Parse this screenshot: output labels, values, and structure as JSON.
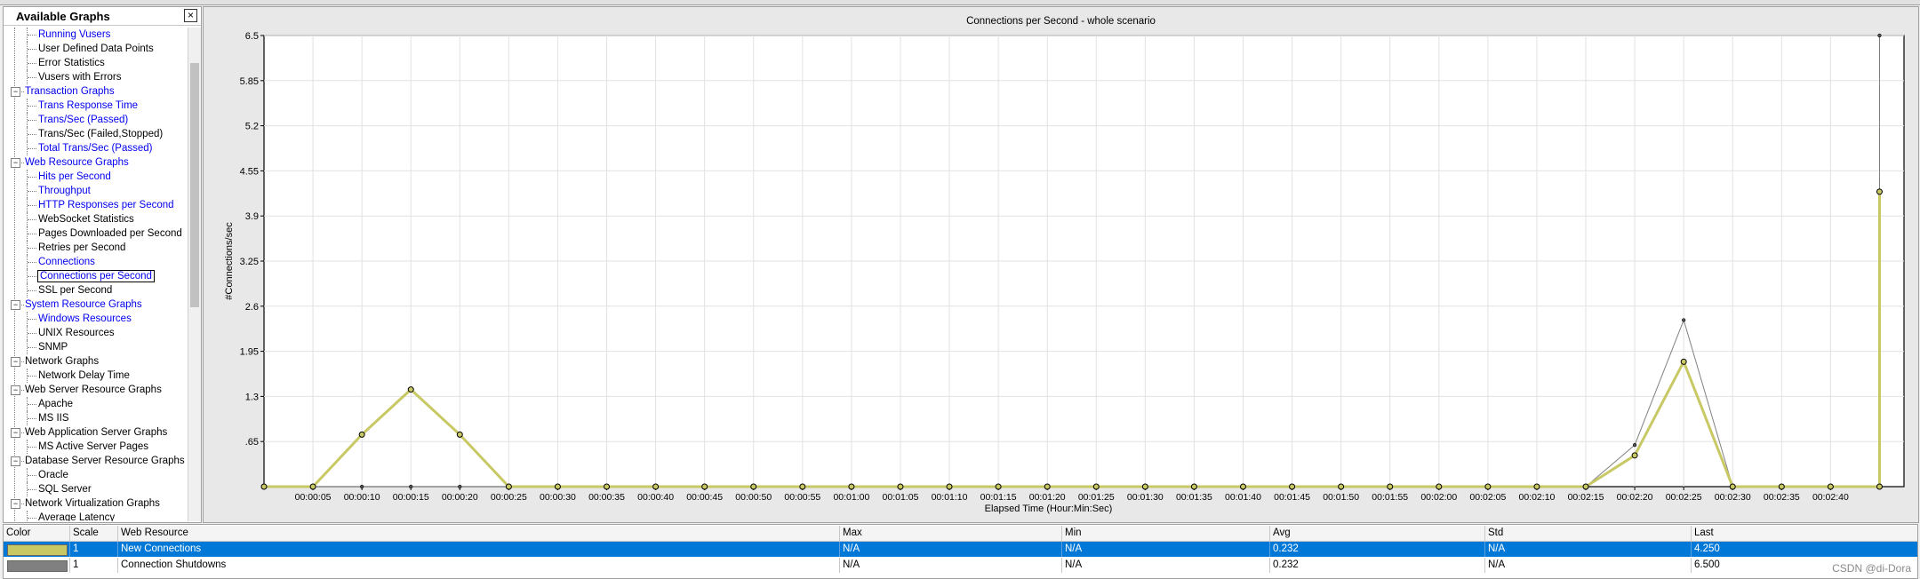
{
  "panel": {
    "title": "Available Graphs",
    "close_label": "×",
    "tree": [
      {
        "label": "Running Vusers",
        "level": 2,
        "link": true
      },
      {
        "label": "User Defined Data Points",
        "level": 2,
        "link": false
      },
      {
        "label": "Error Statistics",
        "level": 2,
        "link": false
      },
      {
        "label": "Vusers with Errors",
        "level": 2,
        "link": false
      },
      {
        "label": "Transaction Graphs",
        "level": 1,
        "link": true,
        "expander": "−"
      },
      {
        "label": "Trans Response Time",
        "level": 2,
        "link": true
      },
      {
        "label": "Trans/Sec (Passed)",
        "level": 2,
        "link": true
      },
      {
        "label": "Trans/Sec (Failed,Stopped)",
        "level": 2,
        "link": false
      },
      {
        "label": "Total Trans/Sec (Passed)",
        "level": 2,
        "link": true
      },
      {
        "label": "Web Resource Graphs",
        "level": 1,
        "link": true,
        "expander": "−"
      },
      {
        "label": "Hits per Second",
        "level": 2,
        "link": true
      },
      {
        "label": "Throughput",
        "level": 2,
        "link": true
      },
      {
        "label": "HTTP Responses per Second",
        "level": 2,
        "link": true
      },
      {
        "label": "WebSocket Statistics",
        "level": 2,
        "link": false
      },
      {
        "label": "Pages Downloaded per Second",
        "level": 2,
        "link": false
      },
      {
        "label": "Retries per Second",
        "level": 2,
        "link": false
      },
      {
        "label": "Connections",
        "level": 2,
        "link": true
      },
      {
        "label": "Connections per Second",
        "level": 2,
        "link": true,
        "selected": true
      },
      {
        "label": "SSL per Second",
        "level": 2,
        "link": false
      },
      {
        "label": "System Resource Graphs",
        "level": 1,
        "link": true,
        "expander": "−"
      },
      {
        "label": "Windows Resources",
        "level": 2,
        "link": true
      },
      {
        "label": "UNIX Resources",
        "level": 2,
        "link": false
      },
      {
        "label": "SNMP",
        "level": 2,
        "link": false
      },
      {
        "label": "Network Graphs",
        "level": 1,
        "link": false,
        "expander": "−"
      },
      {
        "label": "Network Delay Time",
        "level": 2,
        "link": false
      },
      {
        "label": "Web Server Resource Graphs",
        "level": 1,
        "link": false,
        "expander": "−"
      },
      {
        "label": "Apache",
        "level": 2,
        "link": false
      },
      {
        "label": "MS IIS",
        "level": 2,
        "link": false
      },
      {
        "label": "Web Application Server Graphs",
        "level": 1,
        "link": false,
        "expander": "−"
      },
      {
        "label": "MS Active Server Pages",
        "level": 2,
        "link": false
      },
      {
        "label": "Database Server Resource Graphs",
        "level": 1,
        "link": false,
        "expander": "−"
      },
      {
        "label": "Oracle",
        "level": 2,
        "link": false
      },
      {
        "label": "SQL Server",
        "level": 2,
        "link": false
      },
      {
        "label": "Network Virtualization Graphs",
        "level": 1,
        "link": false,
        "expander": "−"
      },
      {
        "label": "Average Latency",
        "level": 2,
        "link": false
      }
    ]
  },
  "chart_data": {
    "type": "line",
    "title": "Connections per Second - whole scenario",
    "xlabel": "Elapsed Time (Hour:Min:Sec)",
    "ylabel": "#Connections/sec",
    "ylim": [
      0,
      6.5
    ],
    "y_ticks": [
      ".65",
      "1.3",
      "1.95",
      "2.6",
      "3.25",
      "3.9",
      "4.55",
      "5.2",
      "5.85",
      "6.5"
    ],
    "x_ticks": [
      "00:00:05",
      "00:00:10",
      "00:00:15",
      "00:00:20",
      "00:00:25",
      "00:00:30",
      "00:00:35",
      "00:00:40",
      "00:00:45",
      "00:00:50",
      "00:00:55",
      "00:01:00",
      "00:01:05",
      "00:01:10",
      "00:01:15",
      "00:01:20",
      "00:01:25",
      "00:01:30",
      "00:01:35",
      "00:01:40",
      "00:01:45",
      "00:01:50",
      "00:01:55",
      "00:02:00",
      "00:02:05",
      "00:02:10",
      "00:02:15",
      "00:02:20",
      "00:02:25",
      "00:02:30",
      "00:02:35",
      "00:02:40"
    ],
    "grid": true,
    "series": [
      {
        "name": "New Connections",
        "color": "#c8c864",
        "x_seconds": [
          0,
          5,
          10,
          15,
          20,
          25,
          30,
          35,
          40,
          45,
          50,
          55,
          60,
          65,
          70,
          75,
          80,
          85,
          90,
          95,
          100,
          105,
          110,
          115,
          120,
          125,
          130,
          135,
          140,
          145,
          150,
          155,
          160,
          165
        ],
        "values": [
          0,
          0,
          0.75,
          1.4,
          0.75,
          0,
          0,
          0,
          0,
          0,
          0,
          0,
          0,
          0,
          0,
          0,
          0,
          0,
          0,
          0,
          0,
          0,
          0,
          0,
          0,
          0,
          0,
          0,
          0.45,
          1.8,
          0,
          0,
          0,
          0,
          4.25
        ]
      },
      {
        "name": "Connection Shutdowns",
        "color": "#808080",
        "x_seconds": [
          0,
          5,
          10,
          15,
          20,
          25,
          30,
          35,
          40,
          45,
          50,
          55,
          60,
          65,
          70,
          75,
          80,
          85,
          90,
          95,
          100,
          105,
          110,
          115,
          120,
          125,
          130,
          135,
          140,
          145,
          150,
          155,
          160,
          165
        ],
        "values": [
          0,
          0,
          0,
          0,
          0,
          0,
          0,
          0,
          0,
          0,
          0,
          0,
          0,
          0,
          0,
          0,
          0,
          0,
          0,
          0,
          0,
          0,
          0,
          0,
          0,
          0,
          0,
          0,
          0.6,
          2.4,
          0,
          0,
          0,
          0,
          6.5
        ]
      }
    ]
  },
  "legend": {
    "headers": {
      "color": "Color",
      "scale": "Scale",
      "resource": "Web Resource",
      "max": "Max",
      "min": "Min",
      "avg": "Avg",
      "std": "Std",
      "last": "Last"
    },
    "rows": [
      {
        "color": "#c8c864",
        "scale": "1",
        "resource": "New Connections",
        "max": "N/A",
        "min": "N/A",
        "avg": "0.232",
        "std": "N/A",
        "last": "4.250"
      },
      {
        "color": "#808080",
        "scale": "1",
        "resource": "Connection Shutdowns",
        "max": "N/A",
        "min": "N/A",
        "avg": "0.232",
        "std": "N/A",
        "last": "6.500"
      }
    ]
  },
  "watermark": "CSDN @di-Dora"
}
